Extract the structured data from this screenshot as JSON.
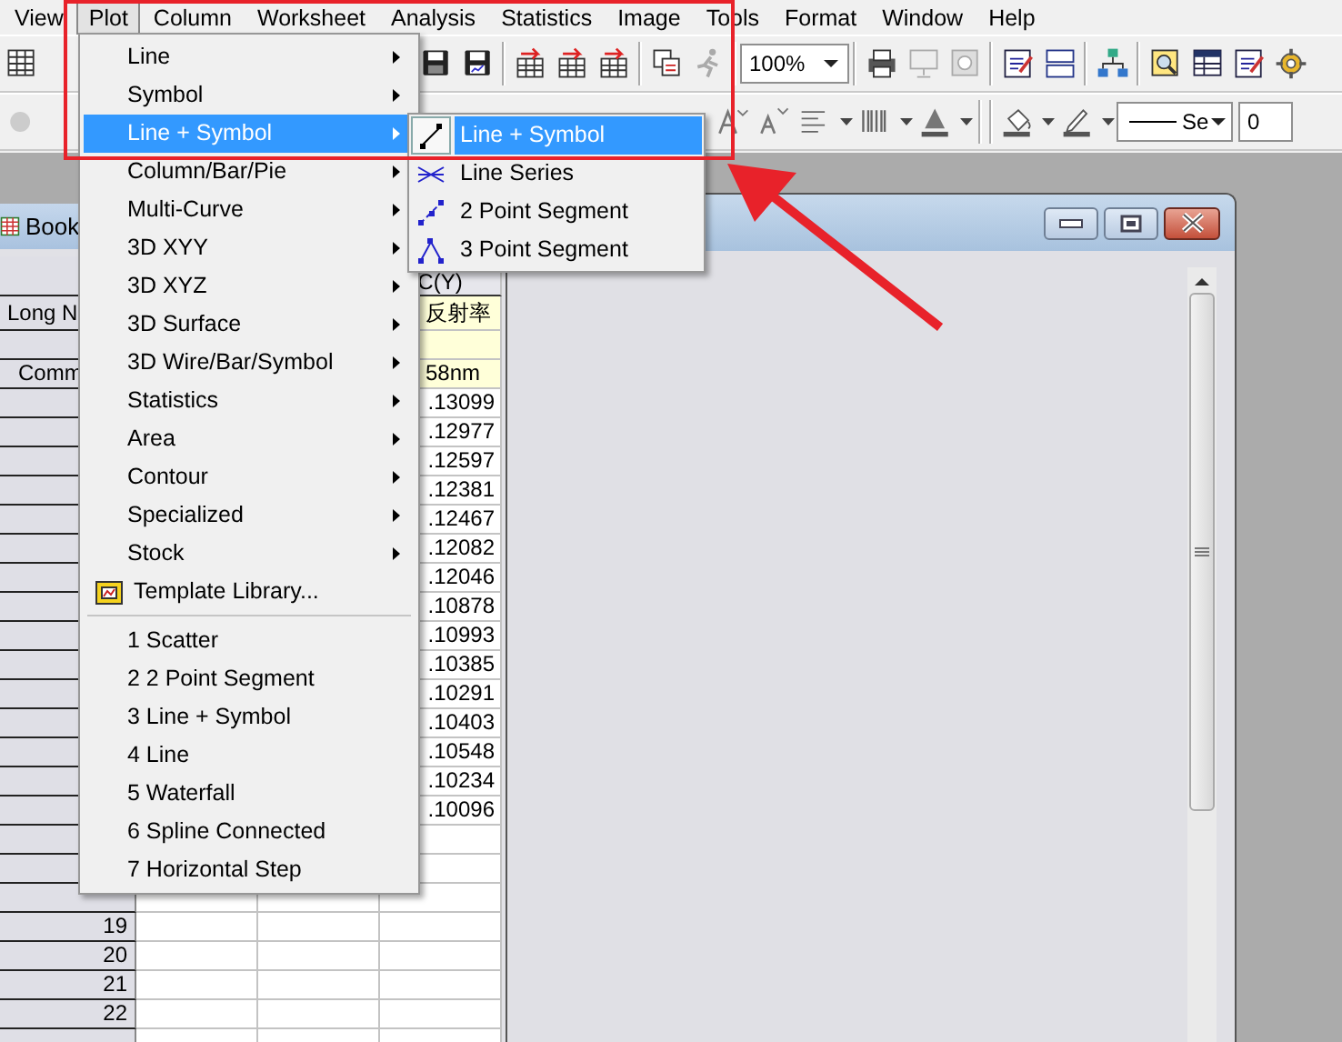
{
  "menubar": [
    {
      "label": "View",
      "selected": false
    },
    {
      "label": "Plot",
      "selected": true
    },
    {
      "label": "Column",
      "selected": false
    },
    {
      "label": "Worksheet",
      "selected": false
    },
    {
      "label": "Analysis",
      "selected": false
    },
    {
      "label": "Statistics",
      "selected": false
    },
    {
      "label": "Image",
      "selected": false
    },
    {
      "label": "Tools",
      "selected": false
    },
    {
      "label": "Format",
      "selected": false
    },
    {
      "label": "Window",
      "selected": false
    },
    {
      "label": "Help",
      "selected": false
    }
  ],
  "toolbar": {
    "zoom": "100%",
    "line_style": "Se",
    "size_field": "0"
  },
  "workbook": {
    "title": "Book",
    "long_name_label": "Long N",
    "comments_label": "Comm",
    "column_header": "C(Y)",
    "long_name": "反射率",
    "comments": "58nm",
    "values": [
      ".13099",
      ".12977",
      ".12597",
      ".12381",
      ".12467",
      ".12082",
      ".12046",
      ".10878",
      ".10993",
      ".10385",
      ".10291",
      ".10403",
      ".10548",
      ".10234",
      ".10096"
    ],
    "row_numbers": [
      "19",
      "20",
      "21",
      "22"
    ]
  },
  "plot_menu": {
    "items": [
      {
        "kind": "submenu",
        "label": "Line",
        "selected": false
      },
      {
        "kind": "submenu",
        "label": "Symbol",
        "selected": false
      },
      {
        "kind": "submenu",
        "label": "Line + Symbol",
        "selected": true
      },
      {
        "kind": "submenu",
        "label": "Column/Bar/Pie",
        "selected": false
      },
      {
        "kind": "submenu",
        "label": "Multi-Curve",
        "selected": false
      },
      {
        "kind": "submenu",
        "label": "3D XYY",
        "selected": false
      },
      {
        "kind": "submenu",
        "label": "3D XYZ",
        "selected": false
      },
      {
        "kind": "submenu",
        "label": "3D Surface",
        "selected": false
      },
      {
        "kind": "submenu",
        "label": "3D Wire/Bar/Symbol",
        "selected": false
      },
      {
        "kind": "submenu",
        "label": "Statistics",
        "selected": false
      },
      {
        "kind": "submenu",
        "label": "Area",
        "selected": false
      },
      {
        "kind": "submenu",
        "label": "Contour",
        "selected": false
      },
      {
        "kind": "submenu",
        "label": "Specialized",
        "selected": false
      },
      {
        "kind": "submenu",
        "label": "Stock",
        "selected": false
      },
      {
        "kind": "icon",
        "label": "Template Library...",
        "selected": false
      },
      {
        "kind": "separator"
      },
      {
        "kind": "plain",
        "label": "1 Scatter",
        "selected": false
      },
      {
        "kind": "plain",
        "label": "2 2 Point Segment",
        "selected": false
      },
      {
        "kind": "plain",
        "label": "3 Line + Symbol",
        "selected": false
      },
      {
        "kind": "plain",
        "label": "4 Line",
        "selected": false
      },
      {
        "kind": "plain",
        "label": "5 Waterfall",
        "selected": false
      },
      {
        "kind": "plain",
        "label": "6 Spline Connected",
        "selected": false
      },
      {
        "kind": "plain",
        "label": "7 Horizontal Step",
        "selected": false
      }
    ]
  },
  "line_symbol_submenu": {
    "items": [
      {
        "label": "Line + Symbol",
        "selected": true
      },
      {
        "label": "Line Series",
        "selected": false
      },
      {
        "label": "2 Point Segment",
        "selected": false
      },
      {
        "label": "3 Point Segment",
        "selected": false
      }
    ]
  }
}
